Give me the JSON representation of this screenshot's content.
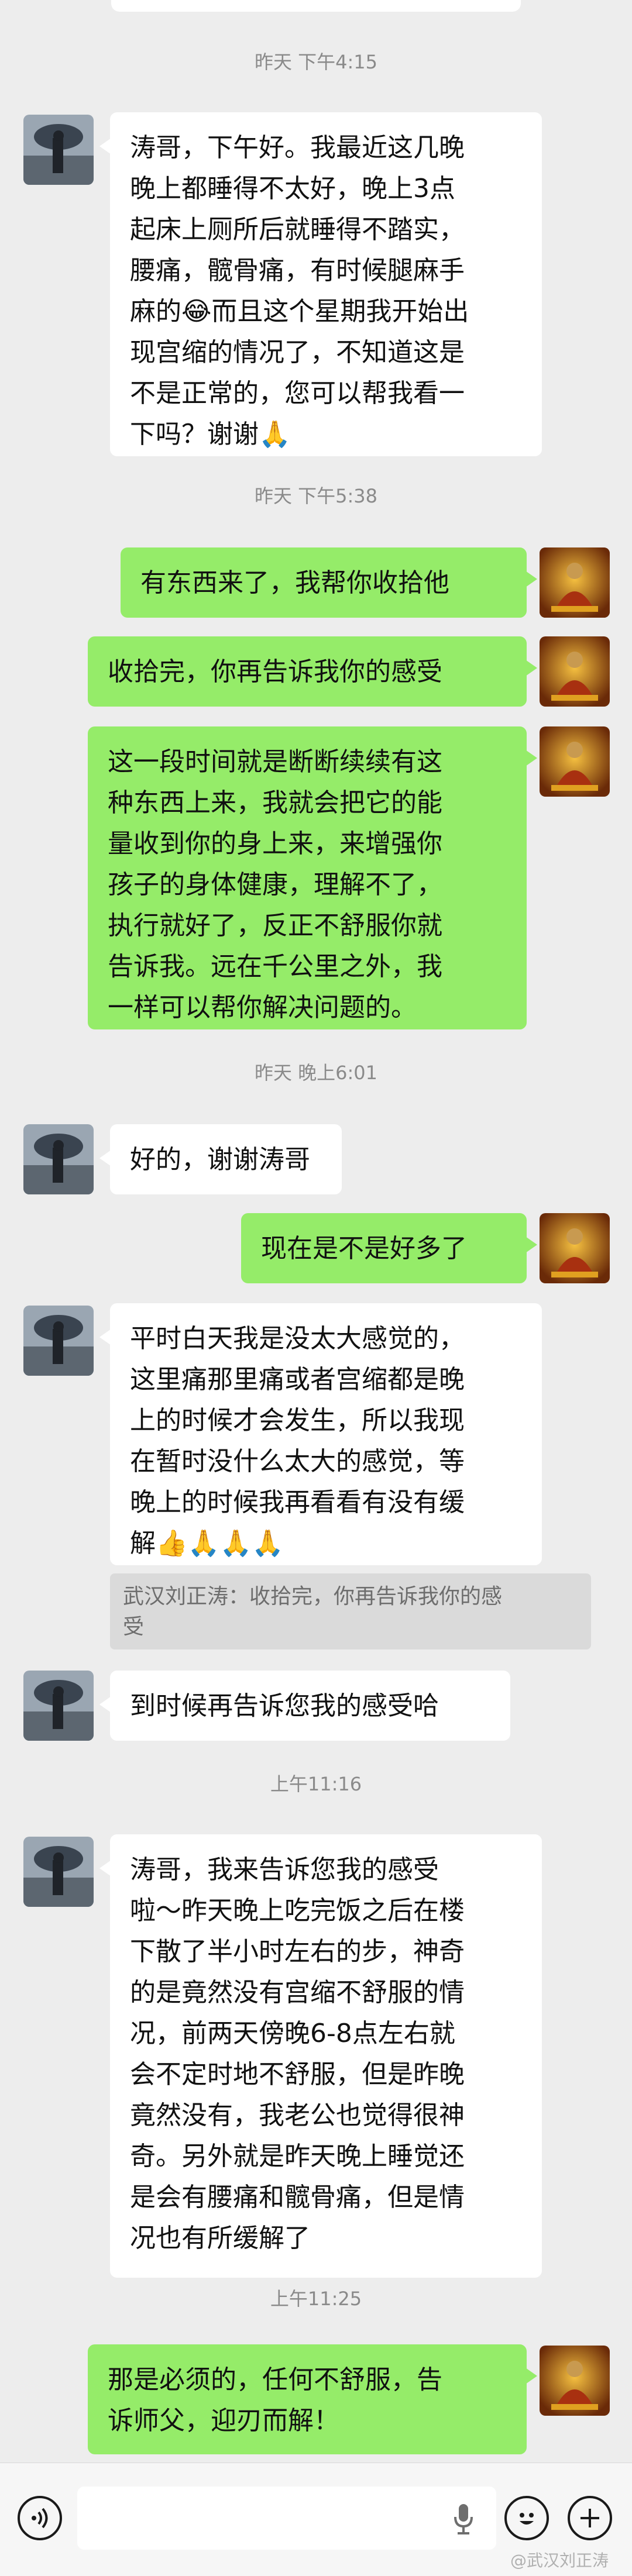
{
  "timestamps": {
    "t1": "昨天 下午4:15",
    "t2": "昨天 下午5:38",
    "t3": "昨天 晚上6:01",
    "t4": "上午11:16",
    "t5": "上午11:25"
  },
  "messages": {
    "m1": {
      "sender": "other",
      "lines": [
        "涛哥，下午好。我最近这几晚",
        "晚上都睡得不太好，晚上3点",
        "起床上厕所后就睡得不踏实，",
        "腰痛，髋骨痛，有时候腿麻手",
        "麻的",
        "而且这个星期我开始出",
        "现宫缩的情况了，不知道这是",
        "不是正常的，您可以帮我看一",
        "下吗？谢谢"
      ],
      "emoji_1": "😂",
      "emoji_2": "🙏"
    },
    "m2": {
      "sender": "me",
      "text": "有东西来了，我帮你收拾他"
    },
    "m3": {
      "sender": "me",
      "text": "收拾完，你再告诉我你的感受"
    },
    "m4": {
      "sender": "me",
      "lines": [
        "这一段时间就是断断续续有这",
        "种东西上来，我就会把它的能",
        "量收到你的身上来，来增强你",
        "孩子的身体健康，理解不了，",
        "执行就好了，反正不舒服你就",
        "告诉我。远在千公里之外，我",
        "一样可以帮你解决问题的。"
      ]
    },
    "m5": {
      "sender": "other",
      "text": "好的，谢谢涛哥"
    },
    "m6": {
      "sender": "me",
      "text": "现在是不是好多了"
    },
    "m7": {
      "sender": "other",
      "lines": [
        "平时白天我是没太大感觉的，",
        "这里痛那里痛或者宫缩都是晚",
        "上的时候才会发生，所以我现",
        "在暂时没什么太大的感觉，等",
        "晚上的时候我再看看有没有缓",
        "解"
      ],
      "emojis": "👍🙏🙏🙏"
    },
    "quote": {
      "lines": [
        "武汉刘正涛：收拾完，你再告诉我你的感",
        "受"
      ]
    },
    "m8": {
      "sender": "other",
      "text": "到时候再告诉您我的感受哈"
    },
    "m9": {
      "sender": "other",
      "lines": [
        "涛哥，我来告诉您我的感受",
        "啦～昨天晚上吃完饭之后在楼",
        "下散了半小时左右的步，神奇",
        "的是竟然没有宫缩不舒服的情",
        "况，前两天傍晚6-8点左右就",
        "会不定时地不舒服，但是昨晚",
        "竟然没有，我老公也觉得很神",
        "奇。另外就是昨天晚上睡觉还",
        "是会有腰痛和髋骨痛，但是情",
        "况也有所缓解了"
      ]
    },
    "m10": {
      "sender": "me",
      "lines": [
        "那是必须的，任何不舒服，告",
        "诉师父，迎刃而解！"
      ]
    }
  },
  "input_bar": {
    "voice_icon": "voice-icon",
    "mic_icon": "mic-icon",
    "emoji_icon": "emoji-icon",
    "plus_icon": "plus-icon"
  },
  "watermark": "@武汉刘正涛",
  "colors": {
    "background": "#ededed",
    "incoming": "#ffffff",
    "outgoing": "#95ec69",
    "timestamp": "#8a8a8a"
  }
}
